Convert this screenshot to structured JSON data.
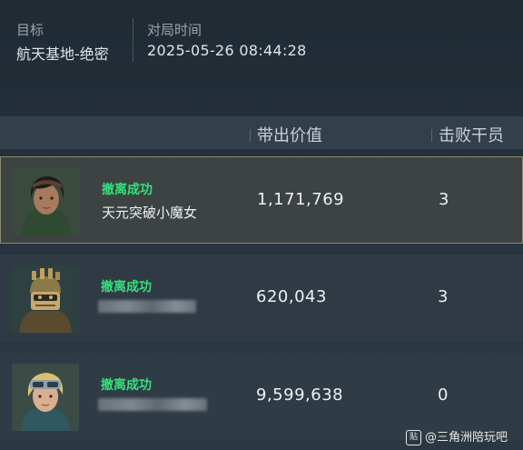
{
  "header": {
    "target_label": "目标",
    "target_value": "航天基地-绝密",
    "time_label": "对局时间",
    "time_value": "2025-05-26 08:44:28"
  },
  "table": {
    "columns": [
      "带出价值",
      "击败干员"
    ],
    "rows": [
      {
        "status": "撤离成功",
        "name": "天元突破小魔女",
        "value": "1,171,769",
        "kills": "3",
        "selected": true
      },
      {
        "status": "撤离成功",
        "name": "",
        "value": "620,043",
        "kills": "3",
        "selected": false
      },
      {
        "status": "撤离成功",
        "name": "",
        "value": "9,599,638",
        "kills": "0",
        "selected": false
      }
    ]
  },
  "watermark": {
    "badge": "贴",
    "text": "@三角洲陪玩吧"
  },
  "colors": {
    "status_green": "#35e07a",
    "selected_border": "#8d8a70"
  }
}
